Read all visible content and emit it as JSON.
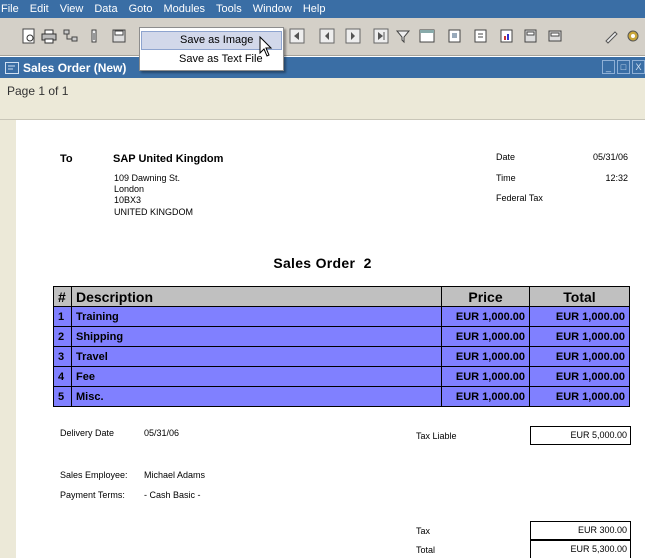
{
  "menu": [
    "File",
    "Edit",
    "View",
    "Data",
    "Goto",
    "Modules",
    "Tools",
    "Window",
    "Help"
  ],
  "dropdown": {
    "items": [
      "Save as Image",
      "Save as Text File"
    ],
    "selected_index": 0
  },
  "window": {
    "title": "Sales Order (New)",
    "buttons": [
      "_",
      "□",
      "X"
    ]
  },
  "preview": {
    "page_label": "Page 1 of 1"
  },
  "document": {
    "to_label": "To",
    "customer": {
      "name": "SAP United Kingdom",
      "address": [
        "109 Dawning St.",
        "London",
        "10BX3",
        "UNITED KINGDOM"
      ]
    },
    "meta": {
      "date_label": "Date",
      "date_value": "05/31/06",
      "time_label": "Time",
      "time_value": "12:32",
      "federal_tax_label": "Federal Tax"
    },
    "title": "Sales Order  2",
    "table": {
      "headers": [
        "#",
        "Description",
        "Price",
        "Total"
      ],
      "rows": [
        [
          "1",
          "Training",
          "EUR 1,000.00",
          "EUR 1,000.00"
        ],
        [
          "2",
          "Shipping",
          "EUR 1,000.00",
          "EUR 1,000.00"
        ],
        [
          "3",
          "Travel",
          "EUR 1,000.00",
          "EUR 1,000.00"
        ],
        [
          "4",
          "Fee",
          "EUR 1,000.00",
          "EUR 1,000.00"
        ],
        [
          "5",
          "Misc.",
          "EUR 1,000.00",
          "EUR 1,000.00"
        ]
      ]
    },
    "delivery_date_label": "Delivery Date",
    "delivery_date_value": "05/31/06",
    "tax_liable_label": "Tax Liable",
    "tax_liable_value": "EUR 5,000.00",
    "sales_employee_label": "Sales Employee:",
    "sales_employee_value": "Michael Adams",
    "payment_terms_label": "Payment Terms:",
    "payment_terms_value": "- Cash Basic -",
    "tax_label": "Tax",
    "tax_value": "EUR 300.00",
    "total_label": "Total",
    "total_value": "EUR 5,300.00"
  },
  "colors": {
    "title_bar": "#3a6ea5",
    "toolbar": "#d4d0c8",
    "row_fill": "#8080ff",
    "header_fill": "#c0c0c0",
    "menu_highlight": "#d2d8ea"
  },
  "icons": [
    "preview-icon",
    "print-icon",
    "tree-icon",
    "binoculars-icon",
    "save-icon",
    "export-icon",
    "first-page-icon",
    "prev-page-icon",
    "next-page-icon",
    "last-page-icon",
    "filter-icon",
    "calendar-icon",
    "document-icon",
    "document2-icon",
    "chart-icon",
    "layout-icon",
    "edit-icon",
    "settings-icon"
  ]
}
